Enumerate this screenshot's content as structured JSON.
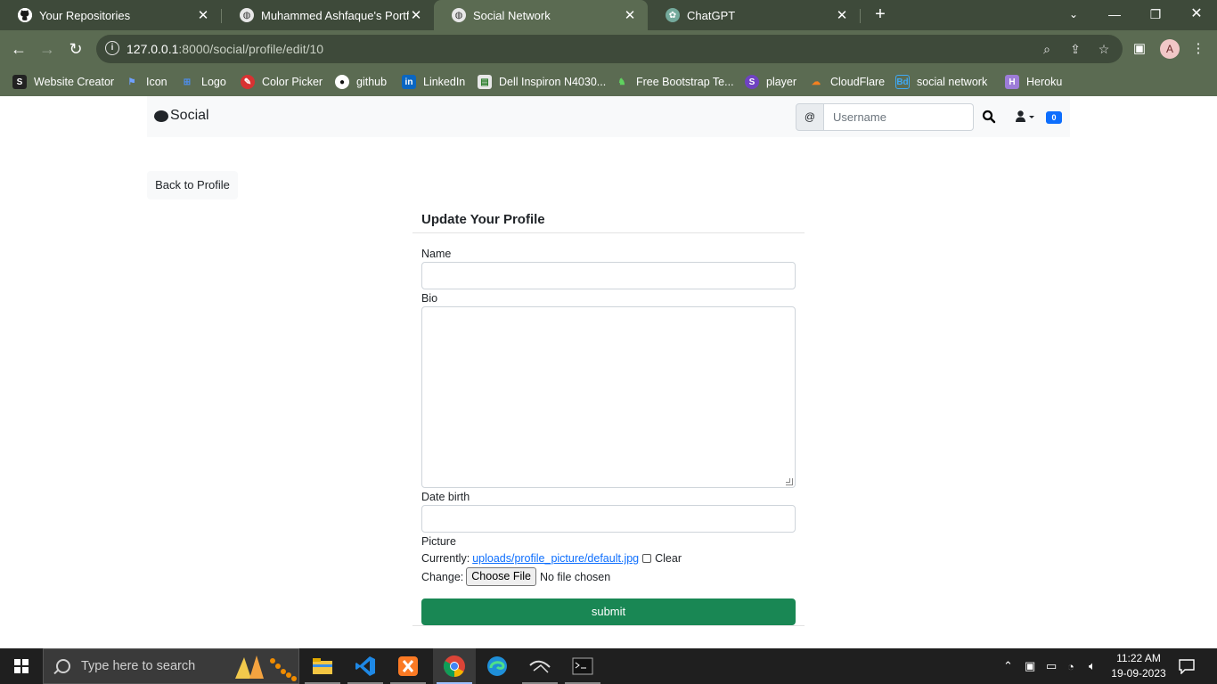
{
  "browser": {
    "tabs": [
      {
        "title": "Your Repositories",
        "icon": "github-icon"
      },
      {
        "title": "Muhammed Ashfaque's Portfolio",
        "icon": "globe-icon"
      },
      {
        "title": "Social Network",
        "icon": "globe-icon",
        "active": true
      },
      {
        "title": "ChatGPT",
        "icon": "chatgpt-icon"
      }
    ],
    "url_host": "127.0.0.1",
    "url_path": ":8000/social/profile/edit/10",
    "profile_initial": "A",
    "bookmarks": [
      {
        "label": "Website Creator",
        "icon": "website-creator-icon",
        "color": "#222222"
      },
      {
        "label": "Icon",
        "icon": "flag-icon",
        "color": "#4a7fd6"
      },
      {
        "label": "Logo",
        "icon": "logo-icon",
        "color": "#2d6fd8"
      },
      {
        "label": "Color Picker",
        "icon": "color-picker-icon",
        "color": "#d83232"
      },
      {
        "label": "github",
        "icon": "github-icon",
        "color": "#111111"
      },
      {
        "label": "LinkedIn",
        "icon": "linkedin-icon",
        "color": "#0a66c2"
      },
      {
        "label": "Dell Inspiron N4030...",
        "icon": "dell-icon",
        "color": "#2a7d2a"
      },
      {
        "label": "Free  Bootstrap Te...",
        "icon": "bootstrap-template-icon",
        "color": "#3a9a3a"
      },
      {
        "label": "player",
        "icon": "player-icon",
        "color": "#6f42c1"
      },
      {
        "label": "CloudFlare",
        "icon": "cloudflare-icon",
        "color": "#f38020"
      },
      {
        "label": "social network",
        "icon": "bd-icon",
        "color": "#3fa9f5"
      },
      {
        "label": "Heroku",
        "icon": "heroku-icon",
        "color": "#9d7cd8"
      }
    ]
  },
  "navbar": {
    "brand": "Social",
    "search_prefix": "@",
    "search_placeholder": "Username",
    "notifications_count": "0"
  },
  "back_button": "Back to Profile",
  "form": {
    "title": "Update Your Profile",
    "name_label": "Name",
    "name_value": "",
    "bio_label": "Bio",
    "bio_value": "",
    "date_label": "Date birth",
    "date_value": "",
    "picture_label": "Picture",
    "currently_label": "Currently:",
    "current_picture": "uploads/profile_picture/default.jpg",
    "clear_label": "Clear",
    "change_label": "Change:",
    "choose_file": "Choose File",
    "no_file": "No file chosen",
    "submit_label": "submit"
  },
  "taskbar": {
    "search_placeholder": "Type here to search",
    "time": "11:22 AM",
    "date": "19-09-2023"
  }
}
